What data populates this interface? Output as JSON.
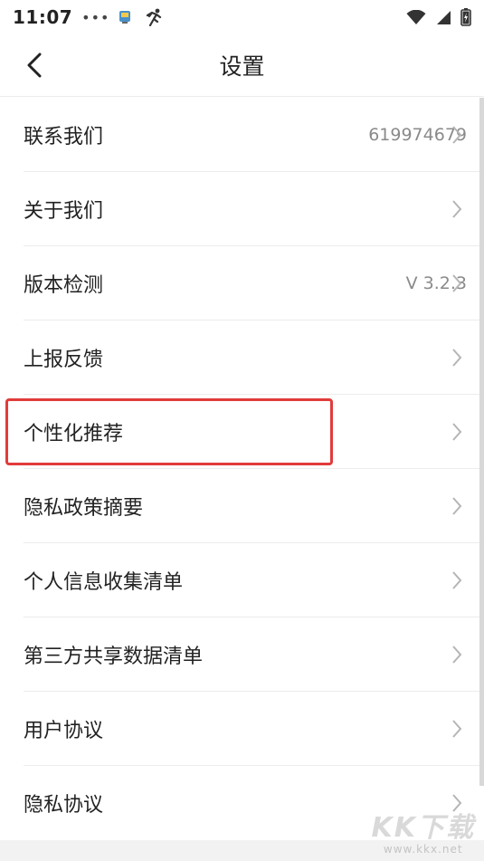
{
  "status_bar": {
    "time": "11:07",
    "dots": "•••"
  },
  "header": {
    "title": "设置"
  },
  "settings": [
    {
      "label": "联系我们",
      "value": "619974679"
    },
    {
      "label": "关于我们",
      "value": ""
    },
    {
      "label": "版本检测",
      "value": "V 3.2.3"
    },
    {
      "label": "上报反馈",
      "value": ""
    },
    {
      "label": "个性化推荐",
      "value": ""
    },
    {
      "label": "隐私政策摘要",
      "value": ""
    },
    {
      "label": "个人信息收集清单",
      "value": ""
    },
    {
      "label": "第三方共享数据清单",
      "value": ""
    },
    {
      "label": "用户协议",
      "value": ""
    },
    {
      "label": "隐私协议",
      "value": ""
    }
  ],
  "watermark": {
    "logo": "KK下载",
    "url": "www.kkx.net"
  },
  "colors": {
    "highlight": "#e23b3b",
    "chevron": "#b5b5b5"
  }
}
